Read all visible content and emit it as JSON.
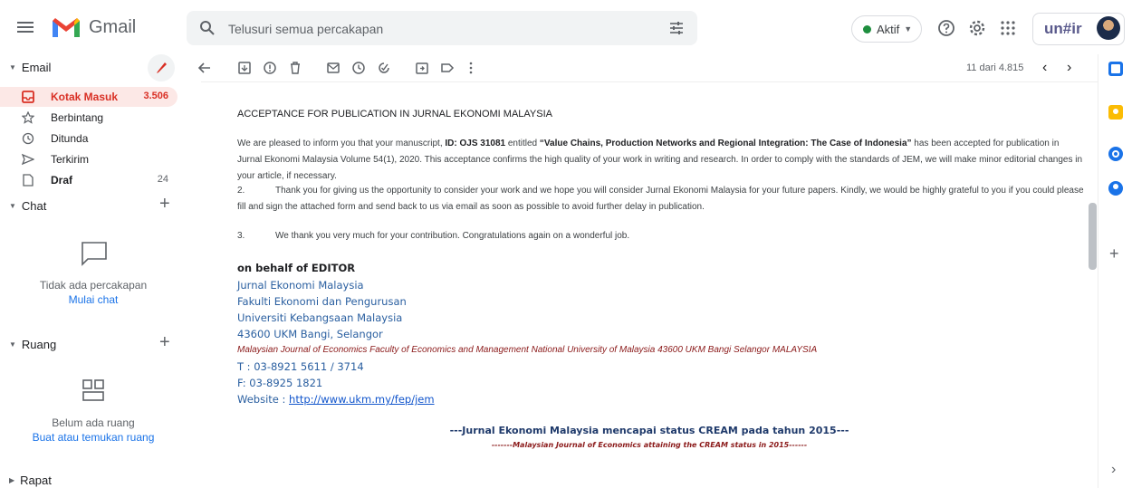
{
  "app": {
    "name": "Gmail",
    "org_logo_text": "un#ir"
  },
  "search": {
    "placeholder": "Telusuri semua percakapan"
  },
  "status": {
    "label": "Aktif"
  },
  "sidebar": {
    "email_header": "Email",
    "items": [
      {
        "label": "Kotak Masuk",
        "count": "3.506",
        "icon": "inbox-icon",
        "active": true
      },
      {
        "label": "Berbintang",
        "count": "",
        "icon": "star-icon"
      },
      {
        "label": "Ditunda",
        "count": "",
        "icon": "clock-icon"
      },
      {
        "label": "Terkirim",
        "count": "",
        "icon": "send-icon"
      },
      {
        "label": "Draf",
        "count": "24",
        "icon": "draft-icon"
      }
    ],
    "chat_header": "Chat",
    "chat_empty": "Tidak ada percakapan",
    "chat_link": "Mulai chat",
    "rooms_header": "Ruang",
    "rooms_empty": "Belum ada ruang",
    "rooms_link": "Buat atau temukan ruang",
    "meet_header": "Rapat"
  },
  "toolbar": {
    "pager": "11 dari 4.815"
  },
  "email": {
    "title": "ACCEPTANCE FOR PUBLICATION IN JURNAL EKONOMI MALAYSIA",
    "p1_a": "We are pleased to inform you that your manuscript, ",
    "p1_id": "ID: OJS 31081",
    "p1_b": " entitled ",
    "p1_title": "“Value Chains, Production Networks and Regional Integration: The Case of Indonesia”",
    "p1_c": " has been accepted for publication in Jurnal Ekonomi Malaysia Volume 54(1), 2020. This acceptance confirms the high quality of your work in writing and research. In order to comply with the standards of JEM, we will make minor editorial changes in your article, if necessary.",
    "p2_num": "2.",
    "p2": "Thank you for giving us the opportunity to consider your work and we hope you will consider Jurnal Ekonomi Malaysia for your future papers. Kindly, we would be highly grateful to you if you could please fill and sign the attached form and send back to us via email as soon as possible to avoid further delay in publication.",
    "p3_num": "3.",
    "p3": "We thank you very much for your contribution. Congratulations again on a wonderful job.",
    "sig_heading": "on behalf of EDITOR",
    "sig_lines": [
      "Jurnal Ekonomi Malaysia",
      "Fakulti Ekonomi dan Pengurusan",
      "Universiti Kebangsaan Malaysia",
      "43600 UKM Bangi, Selangor"
    ],
    "sig_english": "Malaysian Journal of Economics Faculty of Economics and Management National University of Malaysia 43600 UKM Bangi Selangor MALAYSIA",
    "sig_tel": "T : 03-8921 5611 / 3714",
    "sig_fax": "F: 03-8925 1821",
    "sig_web_label": "Website : ",
    "sig_web_url": "http://www.ukm.my/fep/jem",
    "footer_ms": "---Jurnal Ekonomi Malaysia mencapai status CREAM pada tahun 2015---",
    "footer_en": "-------Malaysian Journal of Economics attaining the CREAM status in 2015------"
  },
  "colors": {
    "accent_red": "#d93025",
    "link_blue": "#1a73e8",
    "active_bg": "#fce8e6"
  }
}
